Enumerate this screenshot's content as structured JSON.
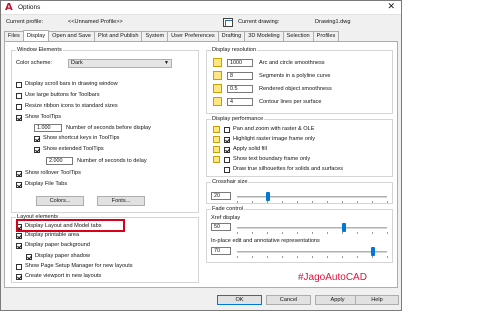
{
  "window": {
    "title": "Options",
    "app_icon_glyph": "A",
    "close_glyph": "✕",
    "accent": "#0078d7",
    "highlight_color": "#d9001b"
  },
  "profile": {
    "current_profile_label": "Current profile:",
    "current_profile_value": "<<Unnamed Profile>>",
    "current_drawing_label": "Current drawing:",
    "current_drawing_value": "Drawing1.dwg"
  },
  "tabs": [
    {
      "label": "Files"
    },
    {
      "label": "Display",
      "active": true
    },
    {
      "label": "Open and Save"
    },
    {
      "label": "Plot and Publish"
    },
    {
      "label": "System"
    },
    {
      "label": "User Preferences"
    },
    {
      "label": "Drafting"
    },
    {
      "label": "3D Modeling"
    },
    {
      "label": "Selection"
    },
    {
      "label": "Profiles"
    }
  ],
  "window_elements": {
    "label": "Window Elements",
    "color_scheme_label": "Color scheme:",
    "color_scheme_value": "Dark",
    "scroll_bars": {
      "label": "Display scroll bars in drawing window",
      "checked": false
    },
    "large_buttons": {
      "label": "Use large buttons for Toolbars",
      "checked": false
    },
    "resize_ribbon": {
      "label": "Resize ribbon icons to standard sizes",
      "checked": false
    },
    "show_tooltips": {
      "label": "Show ToolTips",
      "checked": true
    },
    "seconds_before_display": {
      "value": "1.000",
      "label": "Number of seconds before display"
    },
    "shortcut_keys": {
      "label": "Show shortcut keys in ToolTips",
      "checked": true
    },
    "extended_tooltips": {
      "label": "Show extended ToolTips",
      "checked": true
    },
    "seconds_to_delay": {
      "value": "2.000",
      "label": "Number of seconds to delay"
    },
    "rollover_tooltips": {
      "label": "Show rollover ToolTips",
      "checked": true
    },
    "file_tabs": {
      "label": "Display File Tabs",
      "checked": true
    },
    "colors_button": "Colors...",
    "fonts_button": "Fonts..."
  },
  "layout_elements": {
    "label": "Layout elements",
    "layout_model_tabs": {
      "label": "Display Layout and Model tabs",
      "checked": true
    },
    "printable_area": {
      "label": "Display printable area",
      "checked": true
    },
    "paper_background": {
      "label": "Display paper background",
      "checked": true
    },
    "paper_shadow": {
      "label": "Display paper shadow",
      "checked": true
    },
    "page_setup_manager": {
      "label": "Show Page Setup Manager for new layouts",
      "checked": false
    },
    "create_viewport": {
      "label": "Create viewport in new layouts",
      "checked": true
    }
  },
  "display_resolution": {
    "label": "Display resolution",
    "items": [
      {
        "value": "1000",
        "label": "Arc and circle smoothness"
      },
      {
        "value": "8",
        "label": "Segments in a polyline curve"
      },
      {
        "value": "0.5",
        "label": "Rendered object smoothness"
      },
      {
        "value": "4",
        "label": "Contour lines per surface"
      }
    ]
  },
  "display_performance": {
    "label": "Display performance",
    "items": [
      {
        "label": "Pan and zoom with raster & OLE",
        "checked": false
      },
      {
        "label": "Highlight raster image frame only",
        "checked": true
      },
      {
        "label": "Apply solid fill",
        "checked": true
      },
      {
        "label": "Show text boundary frame only",
        "checked": false
      },
      {
        "label": "Draw true silhouettes for solids and surfaces",
        "checked": false
      }
    ]
  },
  "crosshair": {
    "label": "Crosshair size",
    "value": "20",
    "fraction": 0.2
  },
  "fade_control": {
    "label": "Fade control",
    "xref_label": "Xref display",
    "xref_value": "50",
    "xref_fraction": 0.72,
    "inplace_label": "In-place edit and annotative representations",
    "inplace_value": "70",
    "inplace_fraction": 0.92
  },
  "footer": {
    "ok": "OK",
    "cancel": "Cancel",
    "apply": "Apply",
    "help": "Help"
  },
  "watermark": "#JagoAutoCAD"
}
